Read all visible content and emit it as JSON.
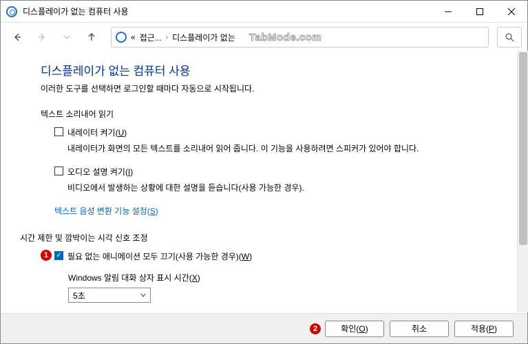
{
  "window": {
    "title": "디스플레이가 없는 컴퓨터 사용"
  },
  "breadcrumb": {
    "root_prefix": "«",
    "crumb1": "접근...",
    "crumb2": "디스플레이가 없는",
    "watermark": "TabMode.com"
  },
  "page": {
    "heading": "디스플레이가 없는 컴퓨터 사용",
    "subtitle": "이러한 도구를 선택하면 로그인할 때마다 자동으로 시작됩니다.",
    "section1_label": "텍스트 소리내어 읽기",
    "narrator": {
      "label_pre": "내레이터 켜기(",
      "label_key": "U",
      "label_post": ")",
      "desc": "내레이터가 화면의 모든 텍스트를 소리내어 읽어 줍니다. 이 기능을 사용하려면 스피커가 있어야 합니다."
    },
    "audio_desc": {
      "label_pre": "오디오 설명 켜기(",
      "label_key": "I",
      "label_post": ")",
      "desc": "비디오에서 발생하는 상황에 대한 설명을 듣습니다(사용 가능한 경우)."
    },
    "tts_link_pre": "텍스트 음성 변환 기능 설정(",
    "tts_link_key": "S",
    "tts_link_post": ")",
    "section2_label": "시간 제한 및 깜박이는 시각 신호 조정",
    "anim": {
      "label_pre": "필요 없는 애니메이션 모두 끄기(사용 가능한 경우)(",
      "label_key": "W",
      "label_post": ")"
    },
    "notify_time_pre": "Windows 알림 대화 상자 표시 시간(",
    "notify_time_key": "X",
    "notify_time_post": ")",
    "notify_value": "5초"
  },
  "buttons": {
    "ok_pre": "확인(",
    "ok_key": "O",
    "ok_post": ")",
    "cancel": "취소",
    "apply_pre": "적용(",
    "apply_key": "P",
    "apply_post": ")"
  },
  "annotations": {
    "a1": "1",
    "a2": "2"
  }
}
